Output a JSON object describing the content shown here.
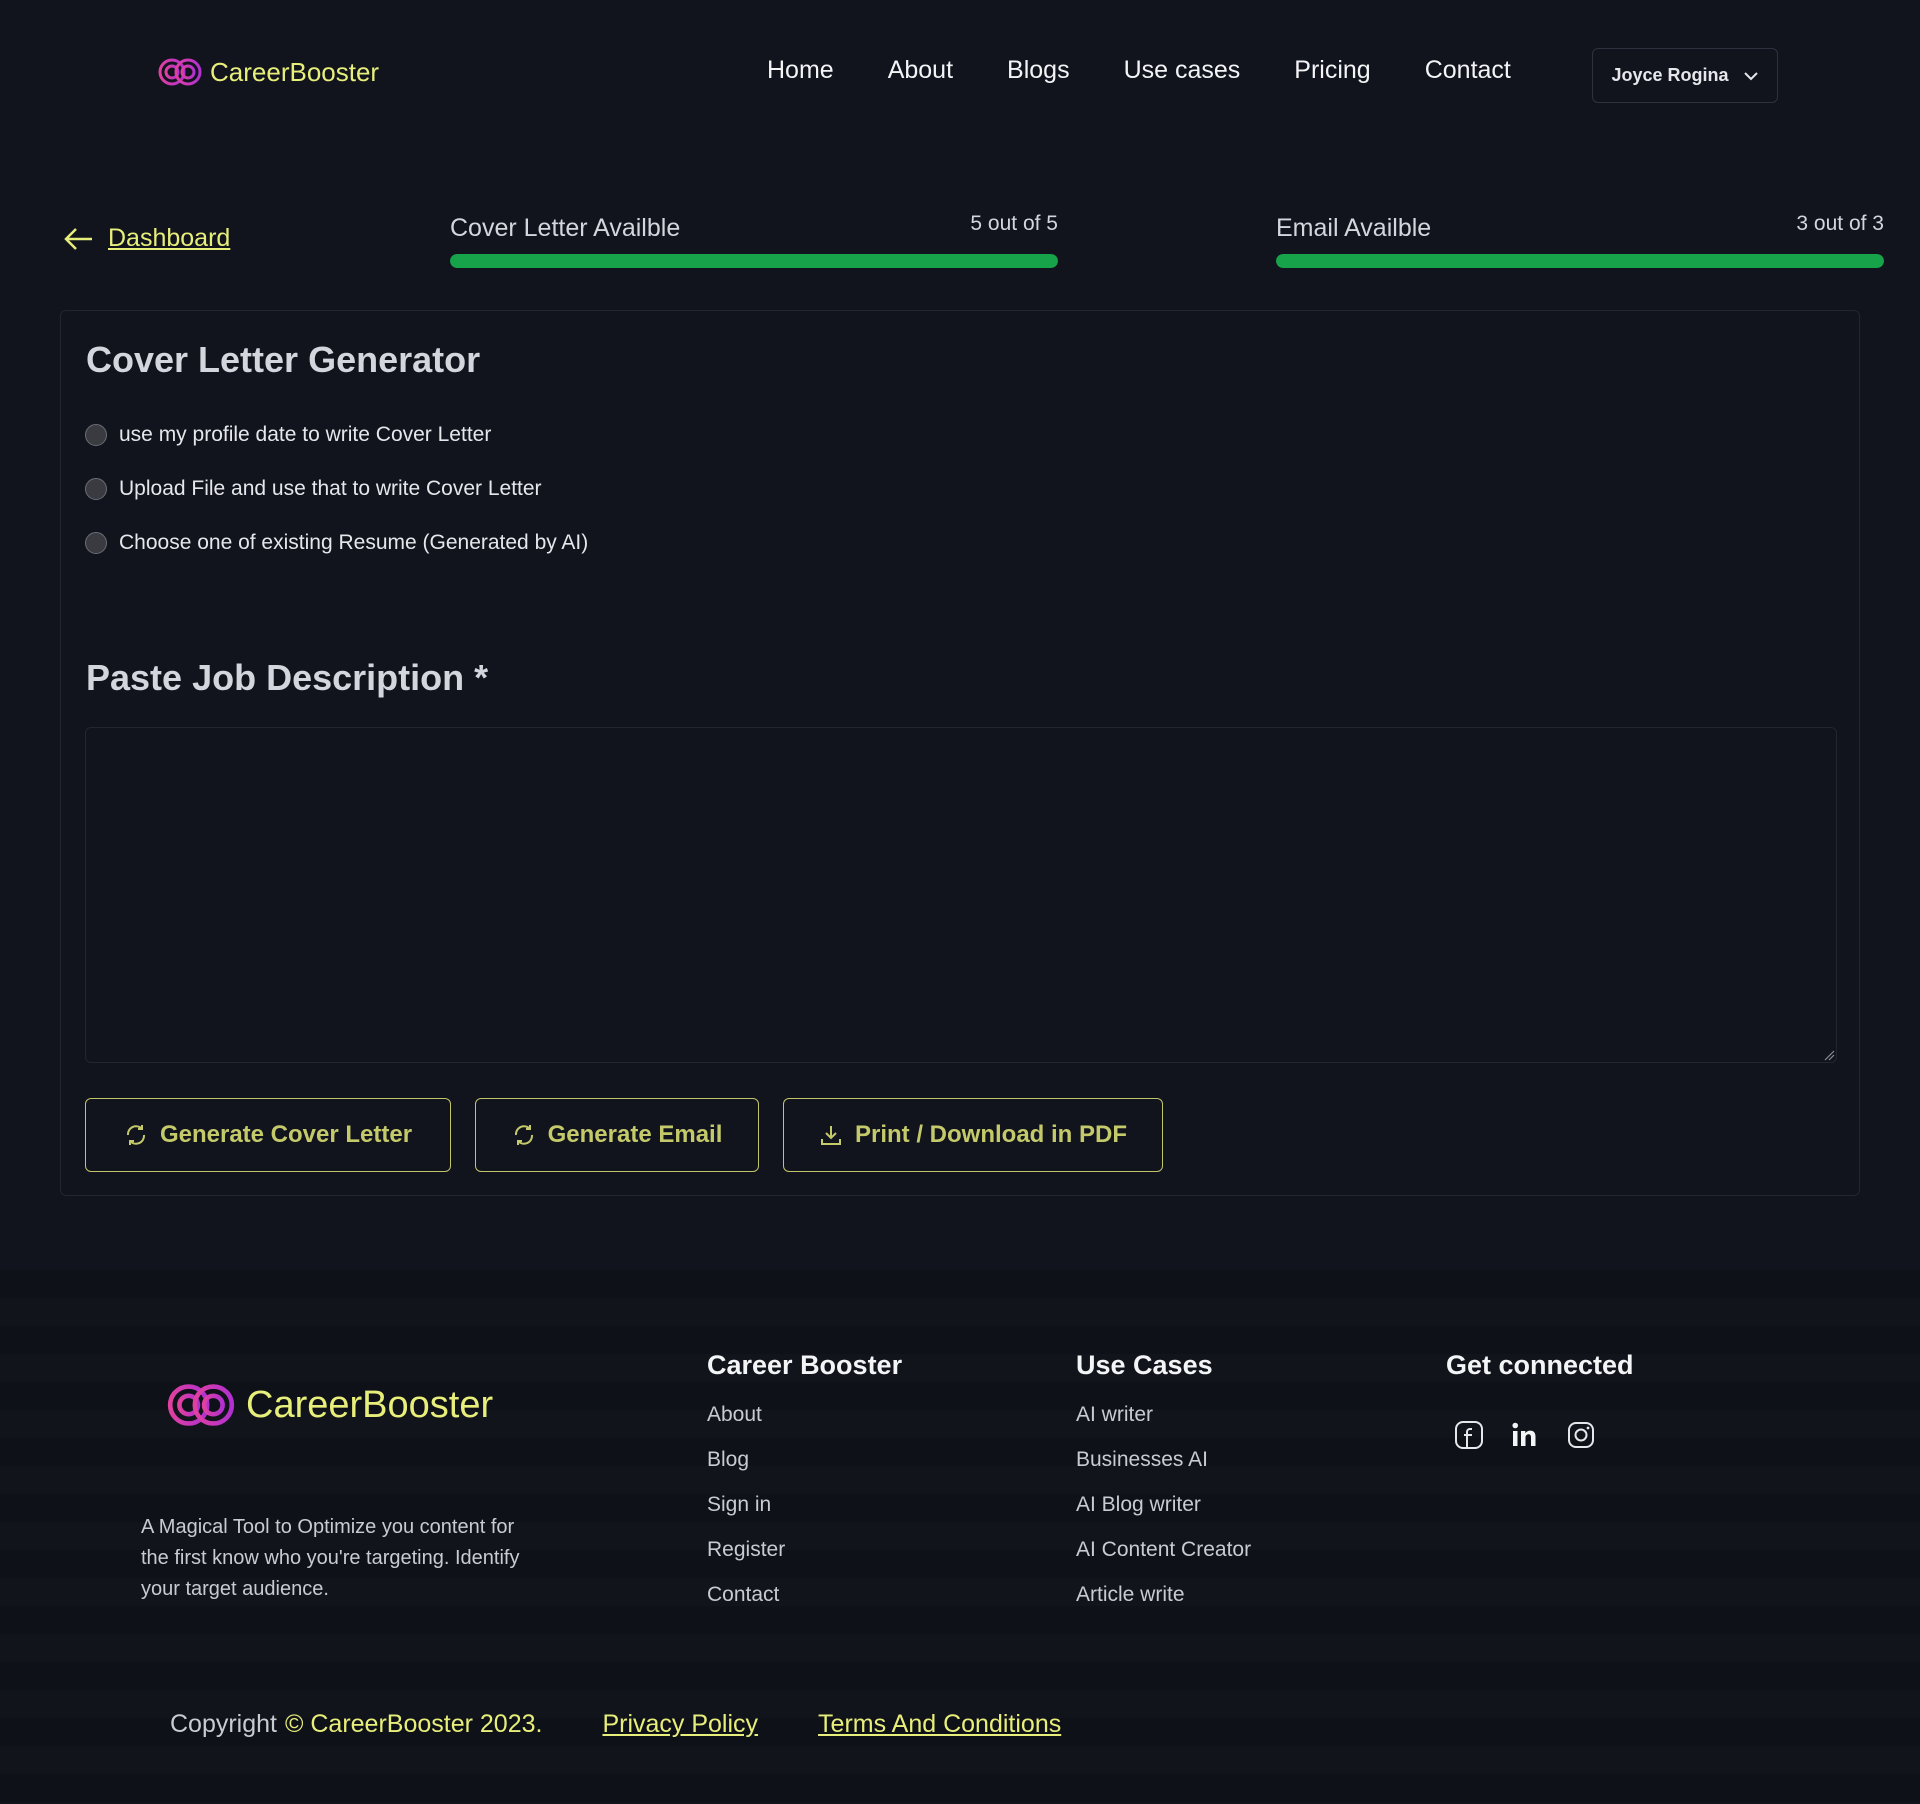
{
  "header": {
    "brand": "CareerBooster",
    "nav": [
      "Home",
      "About",
      "Blogs",
      "Use cases",
      "Pricing",
      "Contact"
    ],
    "user_name": "Joyce Rogina"
  },
  "usage": {
    "back_label": "Dashboard",
    "cover_letter": {
      "label": "Cover Letter Availble",
      "count": "5 out of 5",
      "fill_fraction": 1.0
    },
    "email": {
      "label": "Email Availble",
      "count": "3 out of 3",
      "fill_fraction": 1.0
    }
  },
  "generator": {
    "title": "Cover Letter Generator",
    "options": [
      "use my profile date to write Cover Letter",
      "Upload File and use that to write Cover Letter",
      "Choose one of existing Resume (Generated by AI)"
    ],
    "job_title": "Paste Job Description *",
    "job_value": "",
    "buttons": {
      "generate_cover": "Generate Cover Letter",
      "generate_email": "Generate Email",
      "download": "Print / Download in PDF"
    }
  },
  "footer": {
    "brand": "CareerBooster",
    "tagline": "A Magical Tool to Optimize you content for the first know who you're targeting. Identify your target audience.",
    "col1": {
      "title": "Career Booster",
      "links": [
        "About",
        "Blog",
        "Sign in",
        "Register",
        "Contact"
      ]
    },
    "col2": {
      "title": "Use Cases",
      "links": [
        "AI writer",
        "Businesses AI",
        "AI Blog writer",
        "AI Content Creator",
        "Article write"
      ]
    },
    "col3": {
      "title": "Get connected",
      "icons": [
        "facebook-icon",
        "linkedin-icon",
        "instagram-icon"
      ]
    },
    "copyright_prefix": "Copyright",
    "copyright_brand": "© CareerBooster 2023.",
    "privacy": "Privacy Policy",
    "terms": "Terms And Conditions"
  },
  "colors": {
    "background": "#11131d",
    "accent_yellow": "#e8ee7a",
    "progress_green": "#16a34a",
    "button_text": "#c4c96a"
  }
}
